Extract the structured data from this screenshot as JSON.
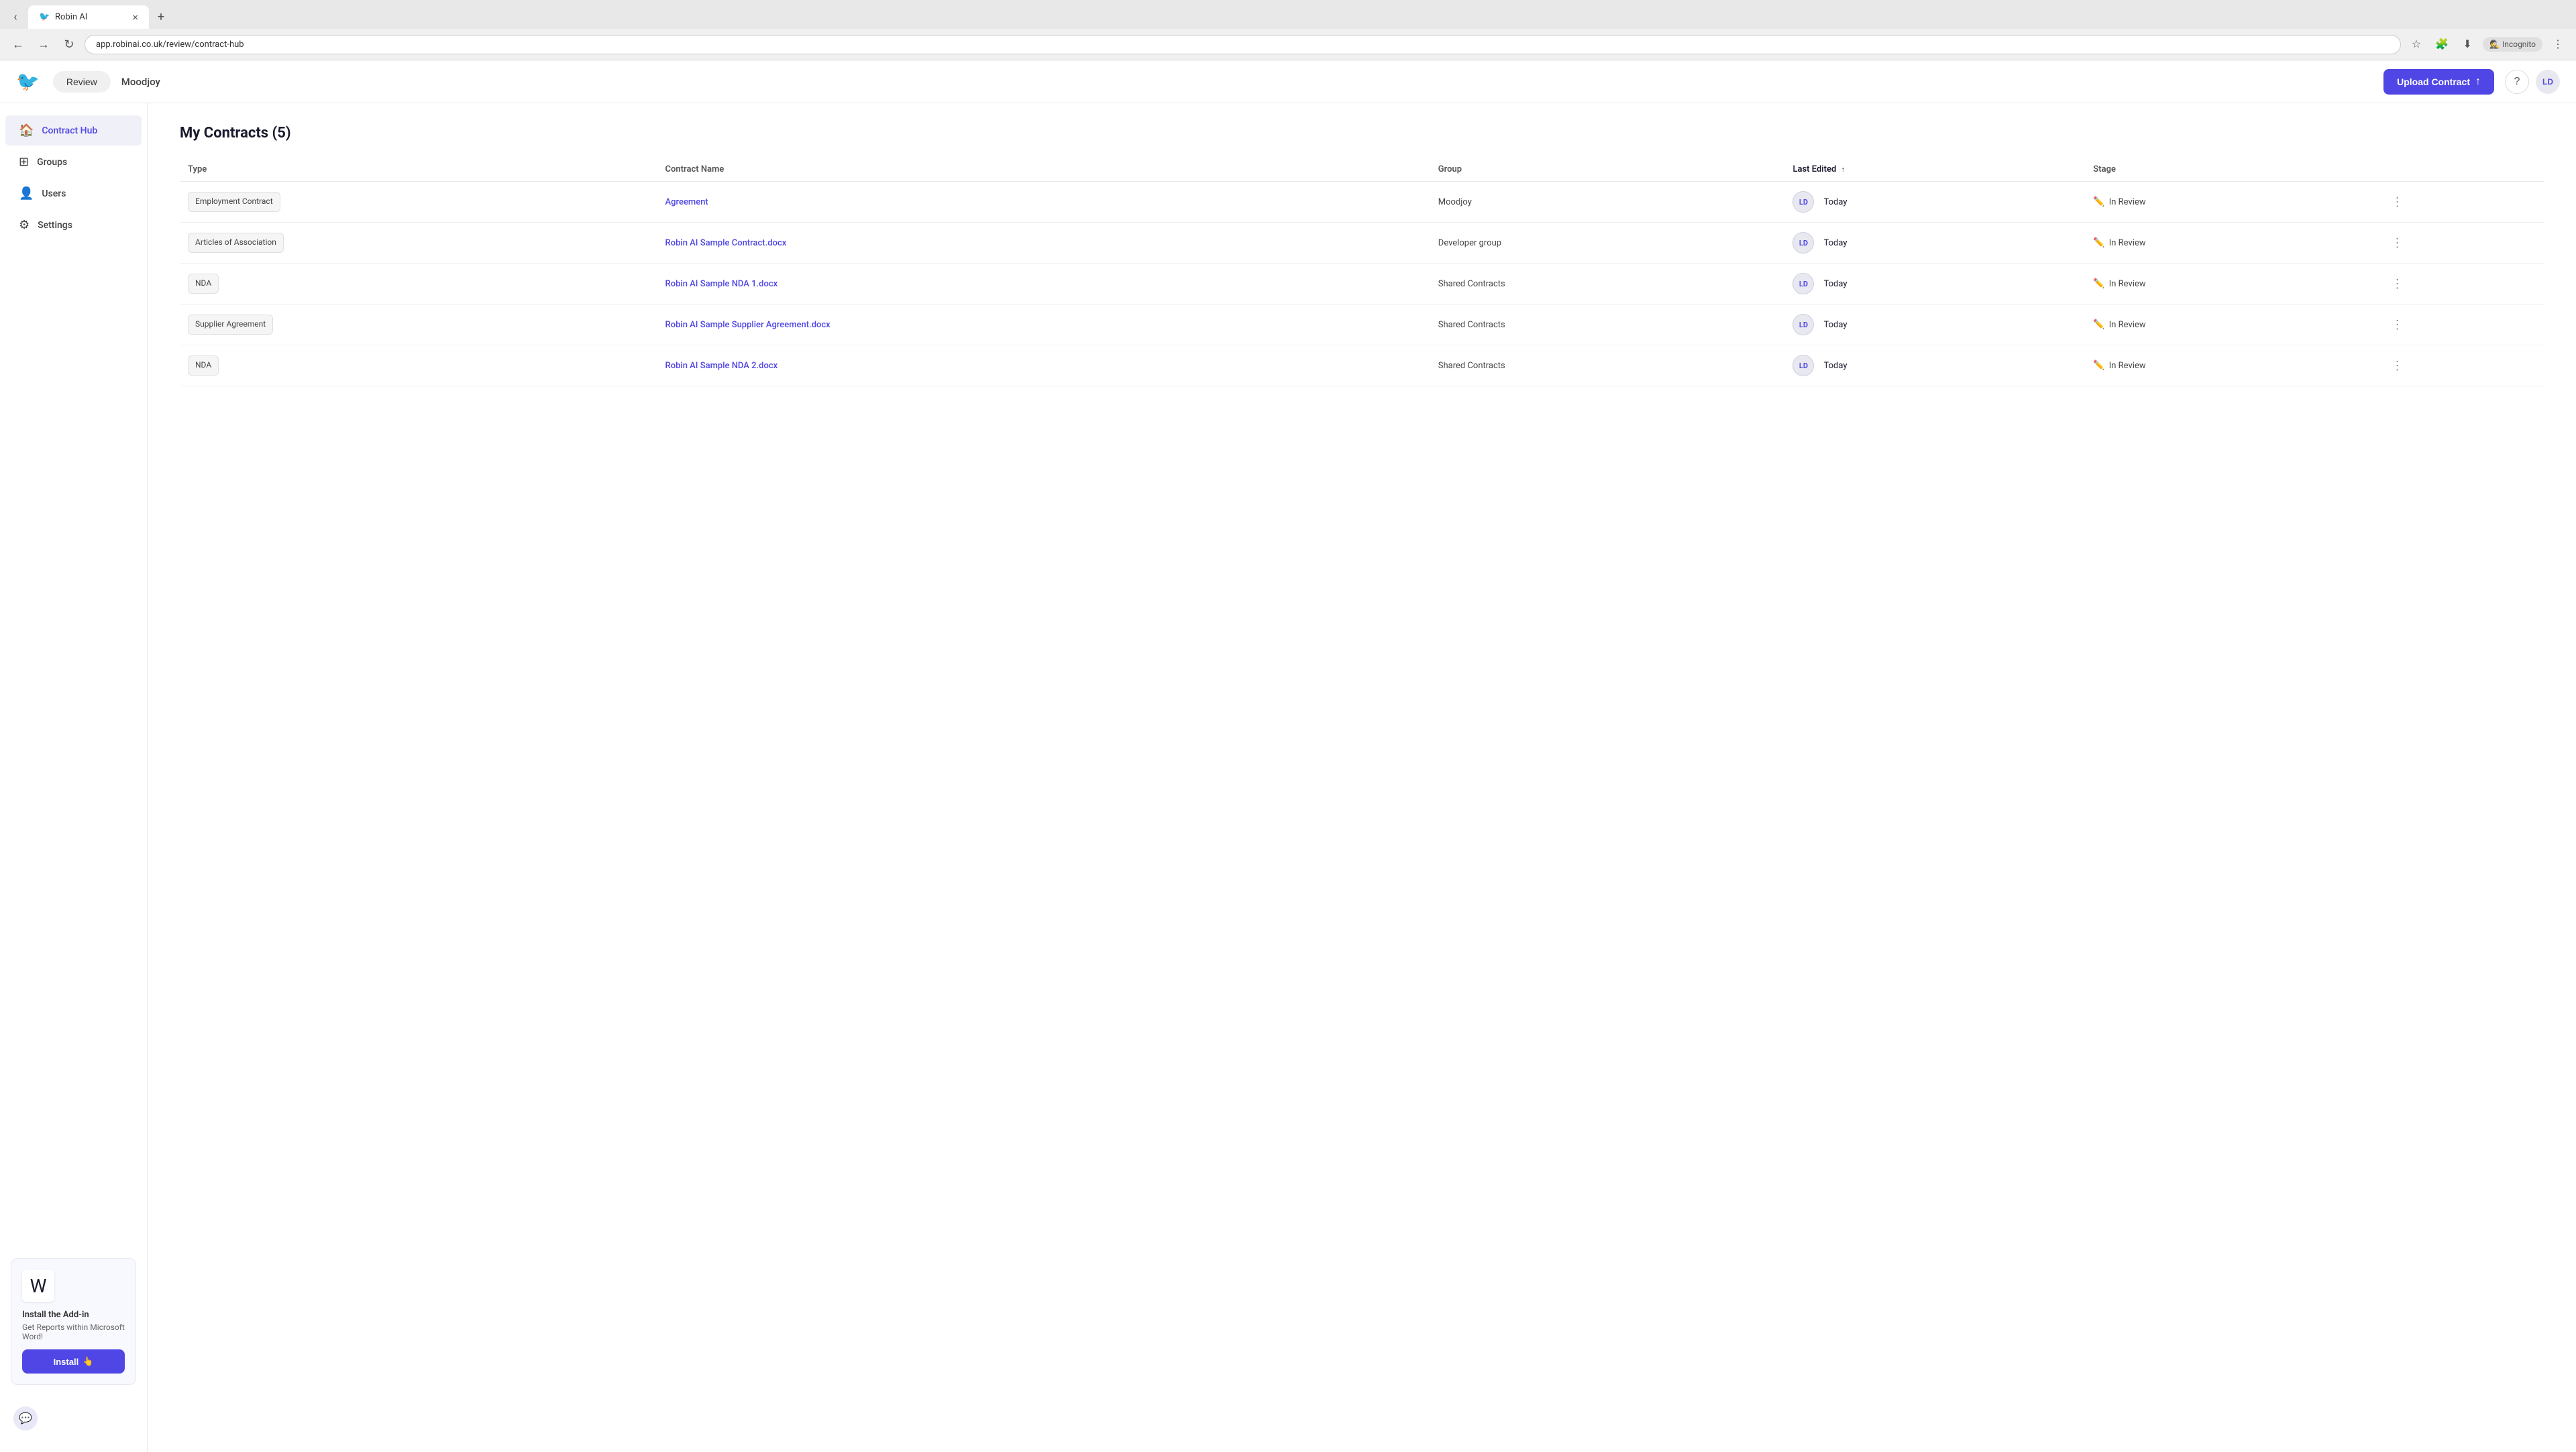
{
  "browser": {
    "tab": {
      "title": "Robin AI",
      "favicon": "🐦",
      "close": "×"
    },
    "address": "app.robinai.co.uk/review/contract-hub",
    "incognito_label": "Incognito"
  },
  "header": {
    "logo": "🐦",
    "review_label": "Review",
    "org_name": "Moodjoy",
    "upload_btn": "Upload Contract",
    "help_icon": "?",
    "avatar": "LD"
  },
  "sidebar": {
    "items": [
      {
        "id": "contract-hub",
        "label": "Contract Hub",
        "icon": "🏠",
        "active": true
      },
      {
        "id": "groups",
        "label": "Groups",
        "icon": "⊞",
        "active": false
      },
      {
        "id": "users",
        "label": "Users",
        "icon": "👤",
        "active": false
      },
      {
        "id": "settings",
        "label": "Settings",
        "icon": "⚙",
        "active": false
      }
    ],
    "addon": {
      "title": "Install the Add-in",
      "description": "Get Reports within Microsoft Word!",
      "install_label": "Install"
    }
  },
  "main": {
    "title": "My Contracts (5)",
    "table": {
      "columns": [
        "Type",
        "Contract Name",
        "Group",
        "Last Edited",
        "Stage"
      ],
      "rows": [
        {
          "type": "Employment Contract",
          "name": "Agreement",
          "group": "Moodjoy",
          "avatar": "LD",
          "last_edited": "Today",
          "stage": "In Review"
        },
        {
          "type": "Articles of Association",
          "name": "Robin AI Sample Contract.docx",
          "group": "Developer group",
          "avatar": "LD",
          "last_edited": "Today",
          "stage": "In Review"
        },
        {
          "type": "NDA",
          "name": "Robin AI Sample NDA 1.docx",
          "group": "Shared Contracts",
          "avatar": "LD",
          "last_edited": "Today",
          "stage": "In Review"
        },
        {
          "type": "Supplier Agreement",
          "name": "Robin AI Sample Supplier Agreement.docx",
          "group": "Shared Contracts",
          "avatar": "LD",
          "last_edited": "Today",
          "stage": "In Review"
        },
        {
          "type": "NDA",
          "name": "Robin AI Sample NDA 2.docx",
          "group": "Shared Contracts",
          "avatar": "LD",
          "last_edited": "Today",
          "stage": "In Review"
        }
      ]
    }
  },
  "colors": {
    "accent": "#4f46e5",
    "sidebar_active_bg": "#f0f0f8",
    "badge_bg": "#f5f5f5"
  }
}
